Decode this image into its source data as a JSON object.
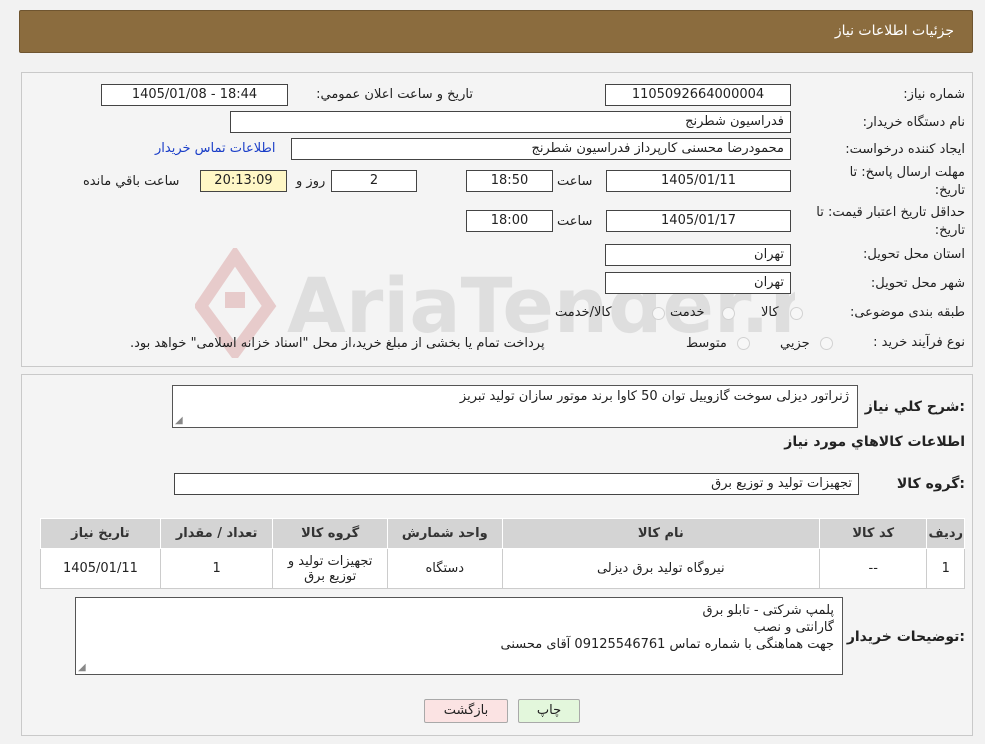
{
  "header": {
    "title": "جزئیات اطلاعات نیاز"
  },
  "form": {
    "need_number_label": "شماره نیاز:",
    "need_number": "1105092664000004",
    "announce_label": "تاریخ و ساعت اعلان عمومي:",
    "announce_value": "1405/01/08 - 18:44",
    "buyer_org_label": "نام دستگاه خريدار:",
    "buyer_org": "فدراسیون شطرنج",
    "creator_label": "ايجاد كننده درخواست:",
    "creator": "محمودرضا محسنی کارپرداز فدراسیون شطرنج",
    "contact_link": "اطلاعات تماس خريدار",
    "deadline_label_1": "مهلت ارسال پاسخ: تا",
    "deadline_label_2": "تاريخ:",
    "deadline_date": "1405/01/11",
    "time_label": "ساعت",
    "deadline_time": "18:50",
    "days_value": "2",
    "days_label": "روز و",
    "remaining_time": "20:13:09",
    "remaining_label": "ساعت باقي مانده",
    "validity_label_1": "حداقل تاريخ اعتبار قيمت: تا",
    "validity_label_2": "تاريخ:",
    "validity_date": "1405/01/17",
    "validity_time": "18:00",
    "province_label": "استان محل تحويل:",
    "province": "تهران",
    "city_label": "شهر محل تحويل:",
    "city": "تهران",
    "category_label": "طبقه بندی موضوعی:",
    "category_options": [
      "كالا",
      "خدمت",
      "كالا/خدمت"
    ],
    "process_label": "نوع فرآيند خريد :",
    "process_options": [
      "جزيي",
      "متوسط"
    ],
    "process_note": "پرداخت تمام يا بخشی از مبلغ خريد،از محل \"اسناد خزانه اسلامی\" خواهد بود."
  },
  "details": {
    "description_label": "شرح كلي نياز:",
    "description": "ژنراتور دیزلی سوخت گازوییل توان 50 کاوا برند موتور سازان تولید تبریز",
    "items_title": "اطلاعات كالاهاي مورد نياز",
    "group_label": "گروه كالا:",
    "group_value": "تجهیزات تولید و توزیع برق",
    "table": {
      "headers": [
        "رديف",
        "كد كالا",
        "نام كالا",
        "واحد شمارش",
        "گروه كالا",
        "تعداد / مقدار",
        "تاريخ نياز"
      ],
      "rows": [
        [
          "1",
          "--",
          "نیروگاه تولید برق دیزلی",
          "دستگاه",
          "تجهیزات تولید و توزیع برق",
          "1",
          "1405/01/11"
        ]
      ]
    },
    "buyer_notes_label": "توضيحات خريدار:",
    "buyer_notes": [
      "پلمپ شرکتی - تابلو برق",
      "گارانتی و نصب",
      "جهت هماهنگی با شماره تماس 09125546761 آقای محسنی"
    ]
  },
  "buttons": {
    "print": "چاپ",
    "back": "بازگشت"
  },
  "watermark_text": "AriaTender.neT",
  "colors": {
    "header_bg": "#8b6c3e",
    "print_bg": "#e3f7dc",
    "back_bg": "#fbe3e3",
    "link": "#1a3ec8"
  }
}
